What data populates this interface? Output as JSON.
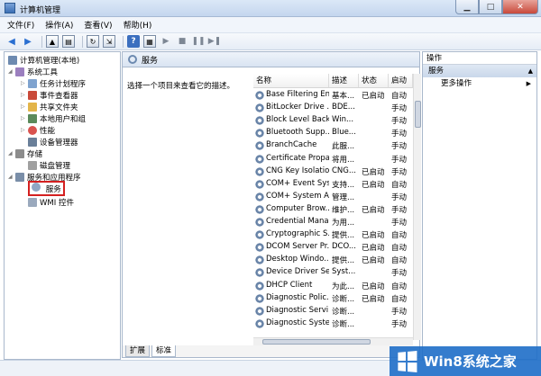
{
  "window": {
    "title": "计算机管理",
    "min_glyph": "▁",
    "max_glyph": "□",
    "close_glyph": "✕"
  },
  "menu": [
    "文件(F)",
    "操作(A)",
    "查看(V)",
    "帮助(H)"
  ],
  "toolbar": {
    "back": "◀",
    "forward": "▶",
    "play": "▶",
    "stop": "■",
    "pause": "❚❚",
    "restart": "▶❚",
    "help": "?"
  },
  "tree": {
    "root": "计算机管理(本地)",
    "items": [
      {
        "label": "系统工具",
        "level": 1
      },
      {
        "label": "任务计划程序",
        "level": 2
      },
      {
        "label": "事件查看器",
        "level": 2
      },
      {
        "label": "共享文件夹",
        "level": 2
      },
      {
        "label": "本地用户和组",
        "level": 2
      },
      {
        "label": "性能",
        "level": 2
      },
      {
        "label": "设备管理器",
        "level": 2
      },
      {
        "label": "存储",
        "level": 1
      },
      {
        "label": "磁盘管理",
        "level": 2
      },
      {
        "label": "服务和应用程序",
        "level": 1
      },
      {
        "label": "服务",
        "level": 2
      },
      {
        "label": "WMI 控件",
        "level": 2
      }
    ]
  },
  "main": {
    "header": "服务",
    "description": "选择一个项目来查看它的描述。",
    "columns": [
      "名称",
      "描述",
      "状态",
      "启动"
    ],
    "rows": [
      {
        "name": "Base Filtering En...",
        "desc": "基本...",
        "status": "已启动",
        "start": "自动"
      },
      {
        "name": "BitLocker Drive ...",
        "desc": "BDE...",
        "status": "",
        "start": "手动"
      },
      {
        "name": "Block Level Back...",
        "desc": "Win...",
        "status": "",
        "start": "手动"
      },
      {
        "name": "Bluetooth Supp...",
        "desc": "Blue...",
        "status": "",
        "start": "手动"
      },
      {
        "name": "BranchCache",
        "desc": "此服...",
        "status": "",
        "start": "手动"
      },
      {
        "name": "Certificate Propa...",
        "desc": "将用...",
        "status": "",
        "start": "手动"
      },
      {
        "name": "CNG Key Isolation",
        "desc": "CNG...",
        "status": "已启动",
        "start": "手动"
      },
      {
        "name": "COM+ Event Sys...",
        "desc": "支持...",
        "status": "已启动",
        "start": "自动"
      },
      {
        "name": "COM+ System A...",
        "desc": "管理...",
        "status": "",
        "start": "手动"
      },
      {
        "name": "Computer Brow...",
        "desc": "维护...",
        "status": "已启动",
        "start": "手动"
      },
      {
        "name": "Credential Mana...",
        "desc": "为用...",
        "status": "",
        "start": "手动"
      },
      {
        "name": "Cryptographic S...",
        "desc": "提供...",
        "status": "已启动",
        "start": "自动"
      },
      {
        "name": "DCOM Server Pr...",
        "desc": "DCO...",
        "status": "已启动",
        "start": "自动"
      },
      {
        "name": "Desktop Windo...",
        "desc": "提供...",
        "status": "已启动",
        "start": "自动"
      },
      {
        "name": "Device Driver Se...",
        "desc": "Syst...",
        "status": "",
        "start": "手动"
      },
      {
        "name": "DHCP Client",
        "desc": "为此...",
        "status": "已启动",
        "start": "自动"
      },
      {
        "name": "Diagnostic Polic...",
        "desc": "诊断...",
        "status": "已启动",
        "start": "自动"
      },
      {
        "name": "Diagnostic Servi...",
        "desc": "诊断...",
        "status": "",
        "start": "手动"
      },
      {
        "name": "Diagnostic Syste...",
        "desc": "诊断...",
        "status": "",
        "start": "手动"
      }
    ],
    "tabs": [
      "扩展",
      "标准"
    ]
  },
  "actions": {
    "title": "操作",
    "section": "服务",
    "more": "更多操作",
    "section_caret": "▲",
    "more_caret": "▶"
  },
  "watermark": "Win8系统之家"
}
